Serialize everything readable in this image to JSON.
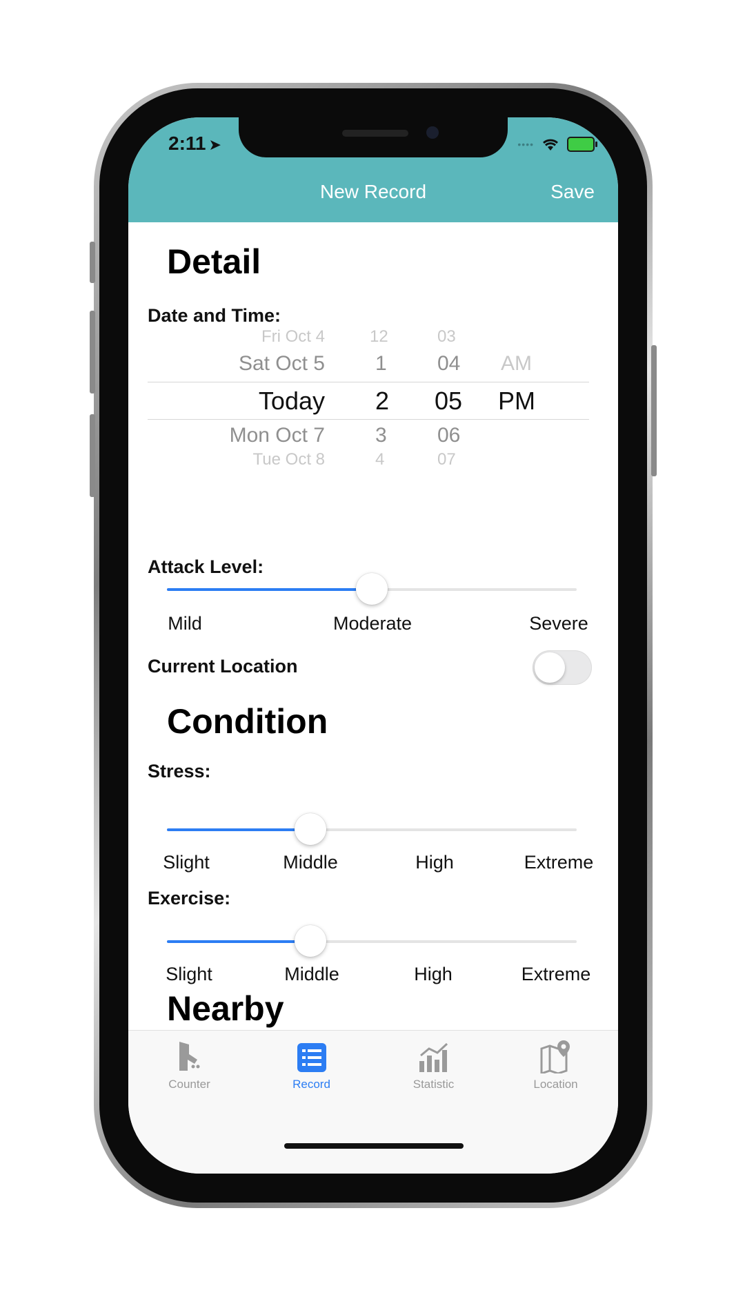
{
  "status_bar": {
    "time": "2:11"
  },
  "nav": {
    "title": "New Record",
    "save_label": "Save"
  },
  "detail": {
    "title": "Detail",
    "datetime_label": "Date and Time:",
    "picker": {
      "dates": [
        "Fri Oct 4",
        "Sat Oct 5",
        "Today",
        "Mon Oct 7",
        "Tue Oct 8"
      ],
      "hours": [
        "12",
        "1",
        "2",
        "3",
        "4"
      ],
      "minutes": [
        "03",
        "04",
        "05",
        "06",
        "07"
      ],
      "periods": [
        "AM",
        "PM"
      ],
      "selected": {
        "date": "Today",
        "hour": "2",
        "minute": "05",
        "period": "PM"
      }
    },
    "attack_label": "Attack Level:",
    "attack_slider": {
      "value_fraction": 0.5,
      "ticks": [
        "Mild",
        "Moderate",
        "Severe"
      ]
    },
    "location_label": "Current Location",
    "location_enabled": false
  },
  "condition": {
    "title": "Condition",
    "stress_label": "Stress:",
    "stress_slider": {
      "value_fraction": 0.35,
      "ticks": [
        "Slight",
        "Middle",
        "High",
        "Extreme"
      ]
    },
    "exercise_label": "Exercise:",
    "exercise_slider": {
      "value_fraction": 0.35,
      "ticks": [
        "Slight",
        "Middle",
        "High",
        "Extreme"
      ]
    }
  },
  "nearby": {
    "title": "Nearby"
  },
  "tabs": [
    {
      "label": "Counter",
      "icon": "counter-icon"
    },
    {
      "label": "Record",
      "icon": "list-icon",
      "active": true
    },
    {
      "label": "Statistic",
      "icon": "bar-chart-icon"
    },
    {
      "label": "Location",
      "icon": "map-pin-icon"
    }
  ],
  "colors": {
    "header": "#5bb7bb",
    "accent": "#2c7df3"
  }
}
